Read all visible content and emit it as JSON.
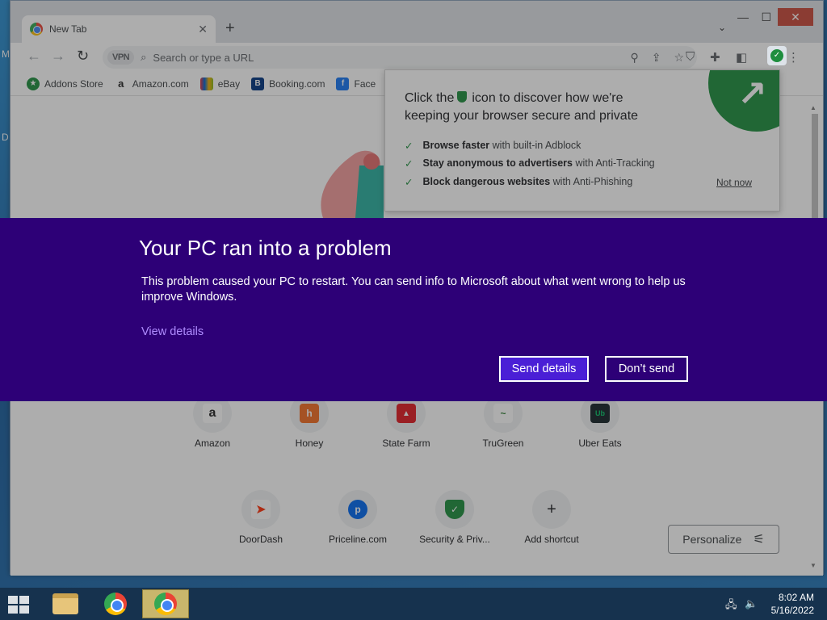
{
  "browser": {
    "tab_title": "New Tab",
    "tab_close": "✕",
    "new_tab": "+",
    "minimize": "—",
    "maximize": "☐",
    "close": "✕",
    "omnibox_placeholder": "Search or type a URL",
    "vpn_label": "VPN"
  },
  "bookmarks": [
    {
      "label": "Addons Store",
      "glyph": "★",
      "color": "#1e8e3e"
    },
    {
      "label": "Amazon.com",
      "glyph": "a",
      "color": "#222222"
    },
    {
      "label": "eBay",
      "glyph": "▦",
      "color": "#e53238"
    },
    {
      "label": "Booking.com",
      "glyph": "B",
      "color": "#003580"
    },
    {
      "label": "Face",
      "glyph": "f",
      "color": "#1877f2"
    }
  ],
  "popup": {
    "head_part1": "Click the",
    "head_part2": "icon to discover how we're",
    "head_line2": "keeping your browser secure and private",
    "features": [
      {
        "bold": "Browse faster",
        "rest": " with built-in Adblock"
      },
      {
        "bold": "Stay anonymous to advertisers",
        "rest": " with Anti-Tracking"
      },
      {
        "bold": "Block dangerous websites",
        "rest": " with Anti-Phishing"
      }
    ],
    "not_now": "Not now"
  },
  "shortcuts": [
    {
      "label": "Amazon",
      "glyph": "a",
      "bg": "#ffffff",
      "fg": "#222222"
    },
    {
      "label": "Honey",
      "glyph": "h",
      "bg": "#f26c22",
      "fg": "#ffffff"
    },
    {
      "label": "State Farm",
      "glyph": "▲",
      "bg": "#e11b22",
      "fg": "#ffffff"
    },
    {
      "label": "TruGreen",
      "glyph": "~",
      "bg": "#ffffff",
      "fg": "#2e7d32"
    },
    {
      "label": "Uber Eats",
      "glyph": "Ub",
      "bg": "#142328",
      "fg": "#06c167"
    },
    {
      "label": "DoorDash",
      "glyph": "➤",
      "bg": "#ffffff",
      "fg": "#ff3008"
    },
    {
      "label": "Priceline.com",
      "glyph": "p",
      "bg": "#0068ef",
      "fg": "#ffffff"
    },
    {
      "label": "Security & Priv...",
      "glyph": "✓",
      "bg": "#1e8e3e",
      "fg": "#ffffff"
    },
    {
      "label": "Add shortcut",
      "glyph": "+",
      "bg": "#f1f3f4",
      "fg": "#202124"
    }
  ],
  "personalize_label": "Personalize",
  "crash": {
    "title": "Your PC ran into a problem",
    "message": "This problem caused your PC to restart. You can send info to Microsoft about what went wrong to help us improve Windows.",
    "view_details": "View details",
    "send_details": "Send details",
    "dont_send": "Don’t send"
  },
  "taskbar": {
    "time": "8:02 AM",
    "date": "5/16/2022"
  },
  "colors": {
    "crash_bg": "#2d0077",
    "send_bg": "#4a1fd6",
    "accent_green": "#1e8e3e"
  }
}
